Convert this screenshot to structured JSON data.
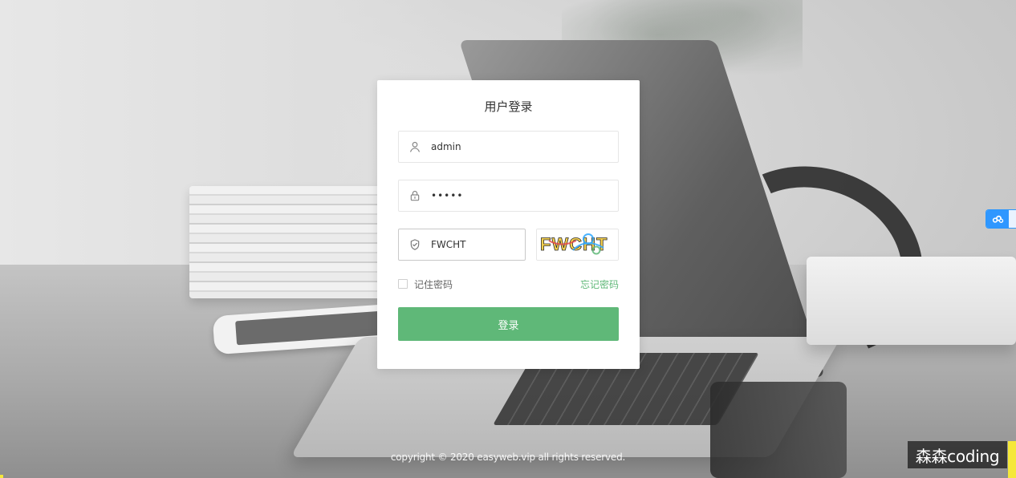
{
  "login": {
    "title": "用户登录",
    "username": {
      "value": "admin",
      "icon": "user-icon"
    },
    "password": {
      "value": "admin",
      "icon": "lock-icon"
    },
    "captcha": {
      "value": "FWCHT",
      "icon": "shield-check-icon",
      "image_text": "FWCHT"
    },
    "remember_label": "记住密码",
    "forgot_label": "忘记密码",
    "submit_label": "登录"
  },
  "footer": {
    "copyright": "copyright © 2020 easyweb.vip all rights reserved."
  },
  "watermark": {
    "text": "森森coding"
  },
  "side_widget": {
    "icon": "cloud-icon"
  },
  "colors": {
    "primary_green": "#5fb878",
    "link_green": "#5fb878",
    "card_bg": "#ffffff",
    "input_border": "#e6e6e6",
    "widget_blue": "#2f97ff"
  }
}
